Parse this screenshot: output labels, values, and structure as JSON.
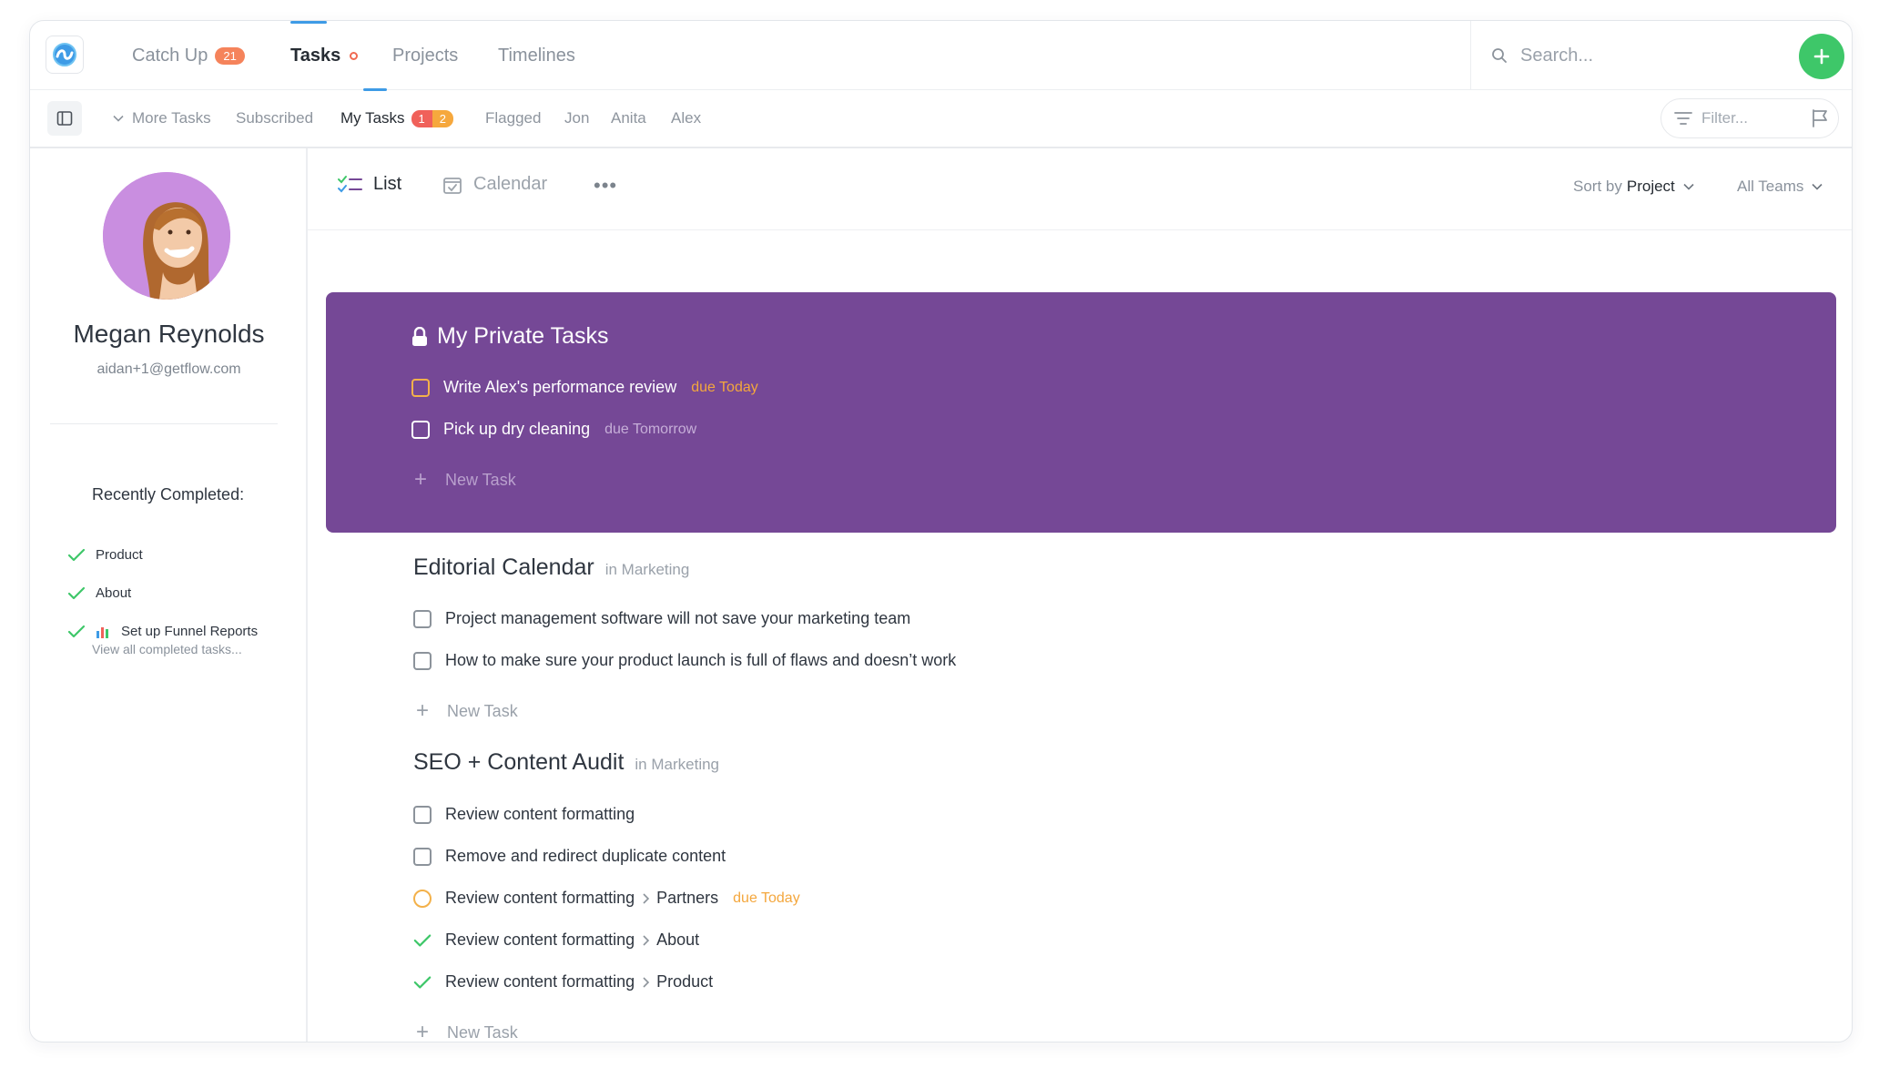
{
  "top_nav": {
    "tabs": [
      {
        "label": "Catch Up",
        "badge": "21"
      },
      {
        "label": "Tasks"
      },
      {
        "label": "Projects"
      },
      {
        "label": "Timelines"
      }
    ],
    "search_placeholder": "Search..."
  },
  "sub_nav": {
    "more_tasks": "More Tasks",
    "items": [
      {
        "label": "Subscribed"
      },
      {
        "label": "My Tasks",
        "badge_1": "1",
        "badge_2": "2"
      },
      {
        "label": "Flagged"
      },
      {
        "label": "Jon"
      },
      {
        "label": "Anita"
      },
      {
        "label": "Alex"
      }
    ],
    "filter_placeholder": "Filter..."
  },
  "profile": {
    "name": "Megan Reynolds",
    "email": "aidan+1@getflow.com",
    "recently_completed_title": "Recently Completed:",
    "recently_completed": [
      {
        "label": "Product"
      },
      {
        "label": "About"
      },
      {
        "label": "Set up Funnel Reports"
      }
    ],
    "view_all": "View all completed tasks..."
  },
  "toolbar": {
    "list_label": "List",
    "calendar_label": "Calendar",
    "sort_prefix": "Sort by",
    "sort_value": "Project",
    "teams_label": "All Teams"
  },
  "private_section": {
    "title": "My Private Tasks",
    "tasks": [
      {
        "title": "Write Alex's performance review",
        "due": "due Today"
      },
      {
        "title": "Pick up dry cleaning",
        "due": "due Tomorrow"
      }
    ],
    "new_task": "New Task"
  },
  "sections": [
    {
      "title": "Editorial Calendar",
      "context": "in Marketing",
      "tasks": [
        {
          "title": "Project management software will not save your marketing team"
        },
        {
          "title": "How to make sure your product launch is full of flaws and doesn’t work"
        }
      ],
      "new_task": "New Task"
    },
    {
      "title": "SEO + Content Audit",
      "context": "in Marketing",
      "tasks": [
        {
          "title": "Review content formatting"
        },
        {
          "title": "Remove and redirect duplicate content"
        },
        {
          "title": "Review content formatting",
          "subtask": "Partners",
          "due": "due Today"
        },
        {
          "title": "Review content formatting",
          "subtask": "About"
        },
        {
          "title": "Review content formatting",
          "subtask": "Product"
        }
      ],
      "new_task": "New Task"
    }
  ],
  "colors": {
    "private_bg": "#754896",
    "accent_blue": "#3e9be6",
    "add_green": "#3ec769",
    "due_orange": "#f4a73d",
    "check_green": "#3ec769"
  }
}
